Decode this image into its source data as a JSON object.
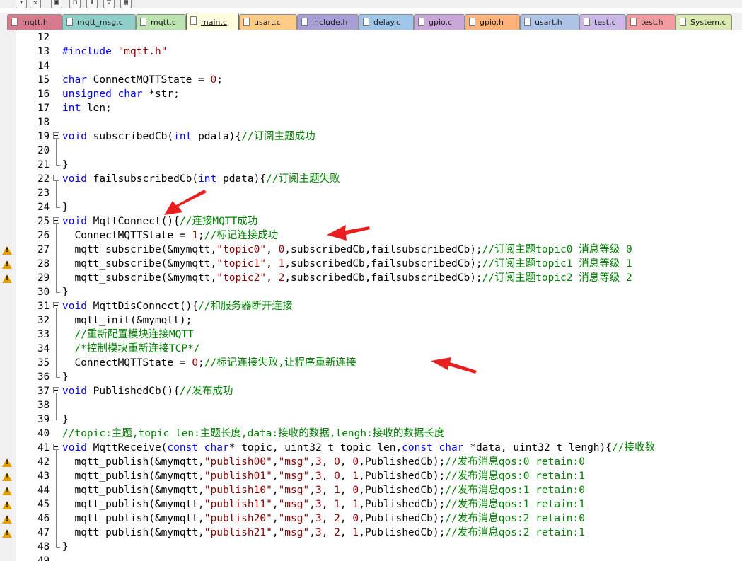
{
  "toolbar_icons": [
    "dropdown-icon",
    "build-icon",
    "stack-icon",
    "download-icon",
    "filter-icon",
    "image-icon"
  ],
  "tabs": [
    {
      "label": "mqtt.h",
      "color": "#d77a8e"
    },
    {
      "label": "mqtt_msg.c",
      "color": "#8ecfc9"
    },
    {
      "label": "mqtt.c",
      "color": "#bce3b0"
    },
    {
      "label": "main.c",
      "color": "#ffff99",
      "active": true
    },
    {
      "label": "usart.c",
      "color": "#ffcc88"
    },
    {
      "label": "include.h",
      "color": "#a89fd6"
    },
    {
      "label": "delay.c",
      "color": "#9fc5e8"
    },
    {
      "label": "gpio.c",
      "color": "#c9a7d9"
    },
    {
      "label": "gpio.h",
      "color": "#ffb27a"
    },
    {
      "label": "usart.h",
      "color": "#aec4e6"
    },
    {
      "label": "test.c",
      "color": "#c9b8e8"
    },
    {
      "label": "test.h",
      "color": "#f29ca0"
    },
    {
      "label": "System.c",
      "color": "#d9e9b0"
    }
  ],
  "lines": [
    {
      "n": "12",
      "fold": "none",
      "parts": []
    },
    {
      "n": "13",
      "fold": "none",
      "parts": [
        {
          "t": "#include ",
          "c": "k"
        },
        {
          "t": "\"mqtt.h\"",
          "c": "s"
        }
      ]
    },
    {
      "n": "14",
      "fold": "none",
      "parts": []
    },
    {
      "n": "15",
      "fold": "none",
      "parts": [
        {
          "t": "char",
          "c": "k"
        },
        {
          "t": " ConnectMQTTState = "
        },
        {
          "t": "0",
          "c": "s"
        },
        {
          "t": ";"
        }
      ]
    },
    {
      "n": "16",
      "fold": "none",
      "parts": [
        {
          "t": "unsigned char",
          "c": "k"
        },
        {
          "t": " *str;"
        }
      ]
    },
    {
      "n": "17",
      "fold": "none",
      "parts": [
        {
          "t": "int",
          "c": "k"
        },
        {
          "t": " len;"
        }
      ]
    },
    {
      "n": "18",
      "fold": "none",
      "parts": []
    },
    {
      "n": "19",
      "fold": "start",
      "parts": [
        {
          "t": "void",
          "c": "k"
        },
        {
          "t": " subscribedCb("
        },
        {
          "t": "int",
          "c": "k"
        },
        {
          "t": " pdata){"
        },
        {
          "t": "//订阅主题成功",
          "c": "c"
        }
      ]
    },
    {
      "n": "20",
      "fold": "mid",
      "parts": []
    },
    {
      "n": "21",
      "fold": "end",
      "parts": [
        {
          "t": "}"
        }
      ]
    },
    {
      "n": "22",
      "fold": "start",
      "parts": [
        {
          "t": "void",
          "c": "k"
        },
        {
          "t": " failsubscribedCb("
        },
        {
          "t": "int",
          "c": "k"
        },
        {
          "t": " pdata){"
        },
        {
          "t": "//订阅主题失败",
          "c": "c"
        }
      ]
    },
    {
      "n": "23",
      "fold": "mid",
      "parts": []
    },
    {
      "n": "24",
      "fold": "end",
      "parts": [
        {
          "t": "}"
        }
      ]
    },
    {
      "n": "25",
      "fold": "start",
      "parts": [
        {
          "t": "void",
          "c": "k"
        },
        {
          "t": " MqttConnect(){"
        },
        {
          "t": "//连接MQTT成功",
          "c": "c"
        }
      ]
    },
    {
      "n": "26",
      "fold": "mid",
      "parts": [
        {
          "t": "  ConnectMQTTState = "
        },
        {
          "t": "1",
          "c": "s"
        },
        {
          "t": ";"
        },
        {
          "t": "//标记连接成功",
          "c": "c"
        }
      ]
    },
    {
      "n": "27",
      "fold": "mid",
      "warn": true,
      "parts": [
        {
          "t": "  mqtt_subscribe(&mymqtt,"
        },
        {
          "t": "\"topic0\"",
          "c": "s"
        },
        {
          "t": ", "
        },
        {
          "t": "0",
          "c": "s"
        },
        {
          "t": ",subscribedCb,failsubscribedCb);"
        },
        {
          "t": "//订阅主题topic0 消息等级 0",
          "c": "c"
        }
      ]
    },
    {
      "n": "28",
      "fold": "mid",
      "warn": true,
      "parts": [
        {
          "t": "  mqtt_subscribe(&mymqtt,"
        },
        {
          "t": "\"topic1\"",
          "c": "s"
        },
        {
          "t": ", "
        },
        {
          "t": "1",
          "c": "s"
        },
        {
          "t": ",subscribedCb,failsubscribedCb);"
        },
        {
          "t": "//订阅主题topic1 消息等级 1",
          "c": "c"
        }
      ]
    },
    {
      "n": "29",
      "fold": "mid",
      "warn": true,
      "parts": [
        {
          "t": "  mqtt_subscribe(&mymqtt,"
        },
        {
          "t": "\"topic2\"",
          "c": "s"
        },
        {
          "t": ", "
        },
        {
          "t": "2",
          "c": "s"
        },
        {
          "t": ",subscribedCb,failsubscribedCb);"
        },
        {
          "t": "//订阅主题topic2 消息等级 2",
          "c": "c"
        }
      ]
    },
    {
      "n": "30",
      "fold": "end",
      "parts": [
        {
          "t": "}"
        }
      ]
    },
    {
      "n": "31",
      "fold": "start",
      "parts": [
        {
          "t": "void",
          "c": "k"
        },
        {
          "t": " MqttDisConnect(){"
        },
        {
          "t": "//和服务器断开连接",
          "c": "c"
        }
      ]
    },
    {
      "n": "32",
      "fold": "mid",
      "parts": [
        {
          "t": "  mqtt_init(&mymqtt);"
        }
      ]
    },
    {
      "n": "33",
      "fold": "mid",
      "parts": [
        {
          "t": "  //重新配置模块连接MQTT",
          "c": "c"
        }
      ]
    },
    {
      "n": "34",
      "fold": "mid",
      "parts": [
        {
          "t": "  /*控制模块重新连接TCP*/",
          "c": "c"
        }
      ]
    },
    {
      "n": "35",
      "fold": "mid",
      "parts": [
        {
          "t": "  ConnectMQTTState = "
        },
        {
          "t": "0",
          "c": "s"
        },
        {
          "t": ";"
        },
        {
          "t": "//标记连接失败,让程序重新连接",
          "c": "c"
        }
      ]
    },
    {
      "n": "36",
      "fold": "end",
      "parts": [
        {
          "t": "}"
        }
      ]
    },
    {
      "n": "37",
      "fold": "start",
      "parts": [
        {
          "t": "void",
          "c": "k"
        },
        {
          "t": " PublishedCb(){"
        },
        {
          "t": "//发布成功",
          "c": "c"
        }
      ]
    },
    {
      "n": "38",
      "fold": "mid",
      "parts": []
    },
    {
      "n": "39",
      "fold": "end",
      "parts": [
        {
          "t": "}"
        }
      ]
    },
    {
      "n": "40",
      "fold": "none",
      "parts": [
        {
          "t": "//topic:主题,topic_len:主题长度,data:接收的数据,lengh:接收的数据长度",
          "c": "c"
        }
      ]
    },
    {
      "n": "41",
      "fold": "start",
      "parts": [
        {
          "t": "void",
          "c": "k"
        },
        {
          "t": " MqttReceive("
        },
        {
          "t": "const char",
          "c": "k"
        },
        {
          "t": "* topic, uint32_t topic_len,"
        },
        {
          "t": "const char",
          "c": "k"
        },
        {
          "t": " *data, uint32_t lengh){"
        },
        {
          "t": "//接收数",
          "c": "c"
        }
      ]
    },
    {
      "n": "42",
      "fold": "mid",
      "warn": true,
      "parts": [
        {
          "t": "  mqtt_publish(&mymqtt,"
        },
        {
          "t": "\"publish00\"",
          "c": "s"
        },
        {
          "t": ","
        },
        {
          "t": "\"msg\"",
          "c": "s"
        },
        {
          "t": ","
        },
        {
          "t": "3",
          "c": "s"
        },
        {
          "t": ", "
        },
        {
          "t": "0",
          "c": "s"
        },
        {
          "t": ", "
        },
        {
          "t": "0",
          "c": "s"
        },
        {
          "t": ",PublishedCb);"
        },
        {
          "t": "//发布消息qos:0 retain:0",
          "c": "c"
        }
      ]
    },
    {
      "n": "43",
      "fold": "mid",
      "warn": true,
      "parts": [
        {
          "t": "  mqtt_publish(&mymqtt,"
        },
        {
          "t": "\"publish01\"",
          "c": "s"
        },
        {
          "t": ","
        },
        {
          "t": "\"msg\"",
          "c": "s"
        },
        {
          "t": ","
        },
        {
          "t": "3",
          "c": "s"
        },
        {
          "t": ", "
        },
        {
          "t": "0",
          "c": "s"
        },
        {
          "t": ", "
        },
        {
          "t": "1",
          "c": "s"
        },
        {
          "t": ",PublishedCb);"
        },
        {
          "t": "//发布消息qos:0 retain:1",
          "c": "c"
        }
      ]
    },
    {
      "n": "44",
      "fold": "mid",
      "warn": true,
      "parts": [
        {
          "t": "  mqtt_publish(&mymqtt,"
        },
        {
          "t": "\"publish10\"",
          "c": "s"
        },
        {
          "t": ","
        },
        {
          "t": "\"msg\"",
          "c": "s"
        },
        {
          "t": ","
        },
        {
          "t": "3",
          "c": "s"
        },
        {
          "t": ", "
        },
        {
          "t": "1",
          "c": "s"
        },
        {
          "t": ", "
        },
        {
          "t": "0",
          "c": "s"
        },
        {
          "t": ",PublishedCb);"
        },
        {
          "t": "//发布消息qos:1 retain:0",
          "c": "c"
        }
      ]
    },
    {
      "n": "45",
      "fold": "mid",
      "warn": true,
      "parts": [
        {
          "t": "  mqtt_publish(&mymqtt,"
        },
        {
          "t": "\"publish11\"",
          "c": "s"
        },
        {
          "t": ","
        },
        {
          "t": "\"msg\"",
          "c": "s"
        },
        {
          "t": ","
        },
        {
          "t": "3",
          "c": "s"
        },
        {
          "t": ", "
        },
        {
          "t": "1",
          "c": "s"
        },
        {
          "t": ", "
        },
        {
          "t": "1",
          "c": "s"
        },
        {
          "t": ",PublishedCb);"
        },
        {
          "t": "//发布消息qos:1 retain:1",
          "c": "c"
        }
      ]
    },
    {
      "n": "46",
      "fold": "mid",
      "warn": true,
      "parts": [
        {
          "t": "  mqtt_publish(&mymqtt,"
        },
        {
          "t": "\"publish20\"",
          "c": "s"
        },
        {
          "t": ","
        },
        {
          "t": "\"msg\"",
          "c": "s"
        },
        {
          "t": ","
        },
        {
          "t": "3",
          "c": "s"
        },
        {
          "t": ", "
        },
        {
          "t": "2",
          "c": "s"
        },
        {
          "t": ", "
        },
        {
          "t": "0",
          "c": "s"
        },
        {
          "t": ",PublishedCb);"
        },
        {
          "t": "//发布消息qos:2 retain:0",
          "c": "c"
        }
      ]
    },
    {
      "n": "47",
      "fold": "mid",
      "warn": true,
      "parts": [
        {
          "t": "  mqtt_publish(&mymqtt,"
        },
        {
          "t": "\"publish21\"",
          "c": "s"
        },
        {
          "t": ","
        },
        {
          "t": "\"msg\"",
          "c": "s"
        },
        {
          "t": ","
        },
        {
          "t": "3",
          "c": "s"
        },
        {
          "t": ", "
        },
        {
          "t": "2",
          "c": "s"
        },
        {
          "t": ", "
        },
        {
          "t": "1",
          "c": "s"
        },
        {
          "t": ",PublishedCb);"
        },
        {
          "t": "//发布消息qos:2 retain:1",
          "c": "c"
        }
      ]
    },
    {
      "n": "48",
      "fold": "end",
      "parts": [
        {
          "t": "}"
        }
      ]
    },
    {
      "n": "49",
      "fold": "none",
      "parts": []
    }
  ],
  "colors": {
    "keyword": "#0000ff",
    "comment": "#008000",
    "string": "#8b0000",
    "annotation_arrow": "#e81f1f",
    "warning": "#e0a000"
  }
}
